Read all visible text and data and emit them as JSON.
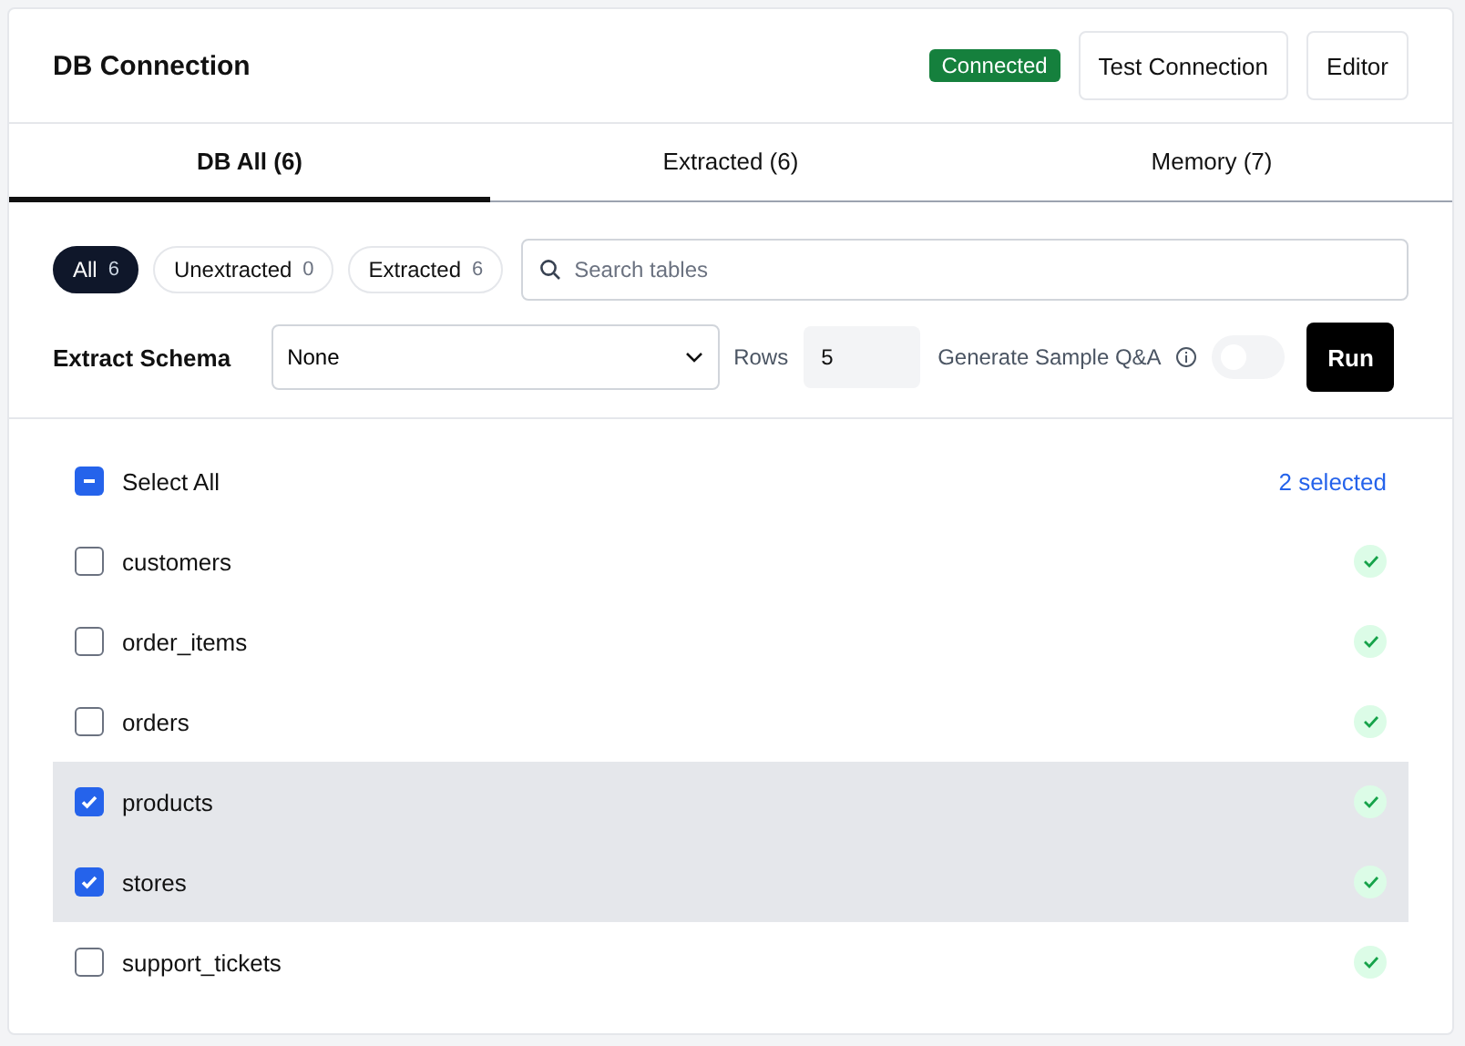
{
  "header": {
    "title": "DB Connection",
    "status": "Connected",
    "buttons": [
      "Test Connection",
      "Editor"
    ]
  },
  "tabs": [
    {
      "label": "DB All (6)",
      "selected": true
    },
    {
      "label": "Extracted (6)",
      "selected": false
    },
    {
      "label": "Memory (7)",
      "selected": false
    }
  ],
  "filters": [
    {
      "label": "All",
      "count": "6",
      "selected": true
    },
    {
      "label": "Unextracted",
      "count": "0",
      "selected": false
    },
    {
      "label": "Extracted",
      "count": "6",
      "selected": false
    }
  ],
  "search": {
    "placeholder": "Search tables"
  },
  "extract": {
    "label": "Extract Schema",
    "schema": "None",
    "rows_label": "Rows",
    "rows": "5",
    "qa_label": "Generate Sample Q&A",
    "qa_on": false,
    "run": "Run"
  },
  "select_all": {
    "label": "Select All",
    "indeterminate": true,
    "count": "2 selected"
  },
  "tables": [
    {
      "name": "customers",
      "selected": false,
      "extracted": true
    },
    {
      "name": "order_items",
      "selected": false,
      "extracted": true
    },
    {
      "name": "orders",
      "selected": false,
      "extracted": true
    },
    {
      "name": "products",
      "selected": true,
      "extracted": true
    },
    {
      "name": "stores",
      "selected": true,
      "extracted": true
    },
    {
      "name": "support_tickets",
      "selected": false,
      "extracted": true
    }
  ]
}
